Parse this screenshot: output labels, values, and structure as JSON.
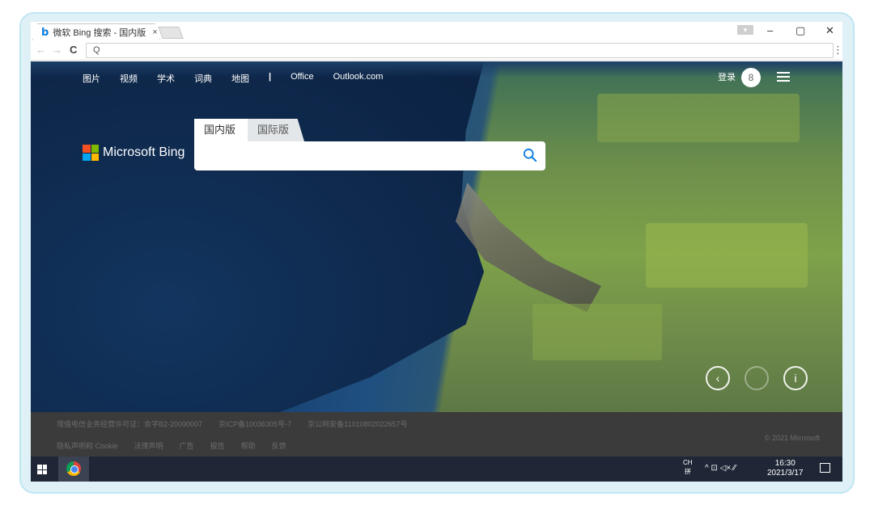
{
  "browser": {
    "tab_title": "微软 Bing 搜索 - 国内版",
    "tab_close": "×",
    "tab_favicon": "b",
    "address_value": "",
    "nav": {
      "back": "←",
      "forward": "→",
      "reload": "C",
      "search_glyph": "Q",
      "menu": "⋮"
    },
    "window_controls": {
      "minimize": "–",
      "restore": "▢",
      "close": "✕"
    }
  },
  "bing": {
    "top_nav": [
      "图片",
      "视频",
      "学术",
      "词典",
      "地图",
      "|",
      "Office",
      "Outlook.com"
    ],
    "login": "登录",
    "avatar_glyph": "8",
    "logo_text": "Microsoft Bing",
    "search_tabs": {
      "domestic": "国内版",
      "international": "国际版"
    },
    "search_placeholder": "",
    "carousel": {
      "prev": "‹",
      "info": "i"
    }
  },
  "footer": {
    "row1": [
      "增值电信业务经营许可证：合字B2-20090007",
      "京ICP备10036305号-7",
      "京公网安备11010802022657号"
    ],
    "row2": [
      "隐私声明和 Cookie",
      "法律声明",
      "广告",
      "报告",
      "帮助",
      "反馈"
    ],
    "copyright": "© 2021 Microsoft"
  },
  "taskbar": {
    "ime_top": "CH",
    "ime_bottom": "拼",
    "tray_icons": "^  ⊡  ◁×  ⁄⁄",
    "time": "16:30",
    "date": "2021/3/17"
  },
  "colors": {
    "bing_blue": "#0c7bdc",
    "taskbar": "#1f2736",
    "footer": "#3b3b3b"
  }
}
